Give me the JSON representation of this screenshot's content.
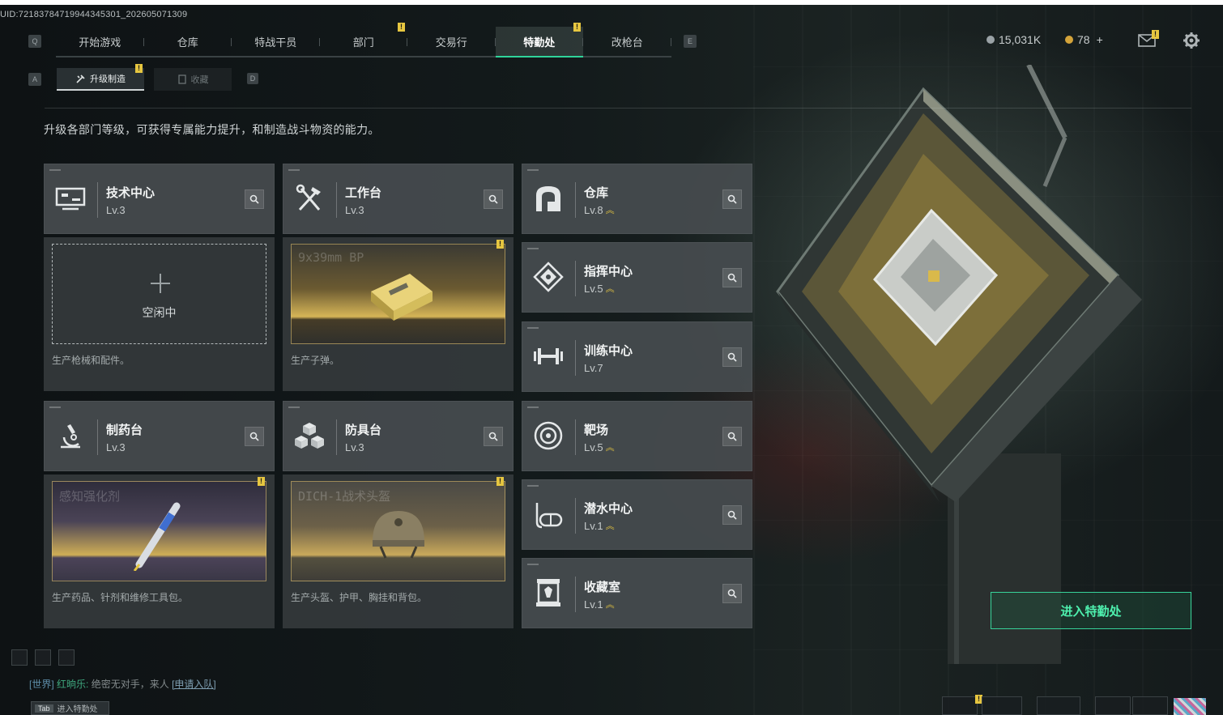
{
  "uid": "UID:72183784719944345301_202605071309",
  "nav": {
    "left_key": "Q",
    "right_key": "E",
    "tabs": [
      {
        "label": "开始游戏"
      },
      {
        "label": "仓库"
      },
      {
        "label": "特战干员"
      },
      {
        "label": "部门",
        "alert": "!"
      },
      {
        "label": "交易行"
      },
      {
        "label": "特勤处",
        "alert": "!",
        "active": true
      },
      {
        "label": "改枪台"
      }
    ]
  },
  "currency": {
    "silver": "15,031K",
    "gold": "78",
    "plus": "+"
  },
  "mail_alert": "!",
  "subnav": {
    "left_key": "A",
    "right_key": "D",
    "active_label": "升级制造",
    "active_alert": "!",
    "inactive_label": "收藏"
  },
  "description": "升级各部门等级，可获得专属能力提升，和制造战斗物资的能力。",
  "departments": {
    "tech": {
      "name": "技术中心",
      "level": "Lv.3"
    },
    "workbench": {
      "name": "工作台",
      "level": "Lv.3"
    },
    "warehouse": {
      "name": "仓库",
      "level": "Lv.8"
    },
    "command": {
      "name": "指挥中心",
      "level": "Lv.5"
    },
    "training": {
      "name": "训练中心",
      "level": "Lv.7"
    },
    "pharmacy": {
      "name": "制药台",
      "level": "Lv.3"
    },
    "armor": {
      "name": "防具台",
      "level": "Lv.3"
    },
    "range": {
      "name": "靶场",
      "level": "Lv.5"
    },
    "diving": {
      "name": "潜水中心",
      "level": "Lv.1"
    },
    "collection": {
      "name": "收藏室",
      "level": "Lv.1"
    }
  },
  "production": {
    "tech": {
      "status": "空闲中",
      "caption": "生产枪械和配件。"
    },
    "workbench": {
      "item": "9x39mm BP",
      "caption": "生产子弹。",
      "alert": "!"
    },
    "pharmacy": {
      "item": "感知强化剂",
      "caption": "生产药品、针剂和维修工具包。",
      "alert": "!"
    },
    "armor": {
      "item": "DICH-1战术头盔",
      "caption": "生产头盔、护甲、胸挂和背包。",
      "alert": "!"
    }
  },
  "enter_button": "进入特勤处",
  "chat": {
    "channel": "[世界]",
    "user": "红晌乐:",
    "message": "绝密无对手，来人",
    "action": "[申请入队]"
  },
  "tab_hint": {
    "key": "Tab",
    "label": "进入特勤处"
  },
  "bottom_alert": "!",
  "colors": {
    "accent_green": "#2fd49a",
    "alert_yellow": "#e6c640",
    "card_bg": "#464c4f"
  }
}
